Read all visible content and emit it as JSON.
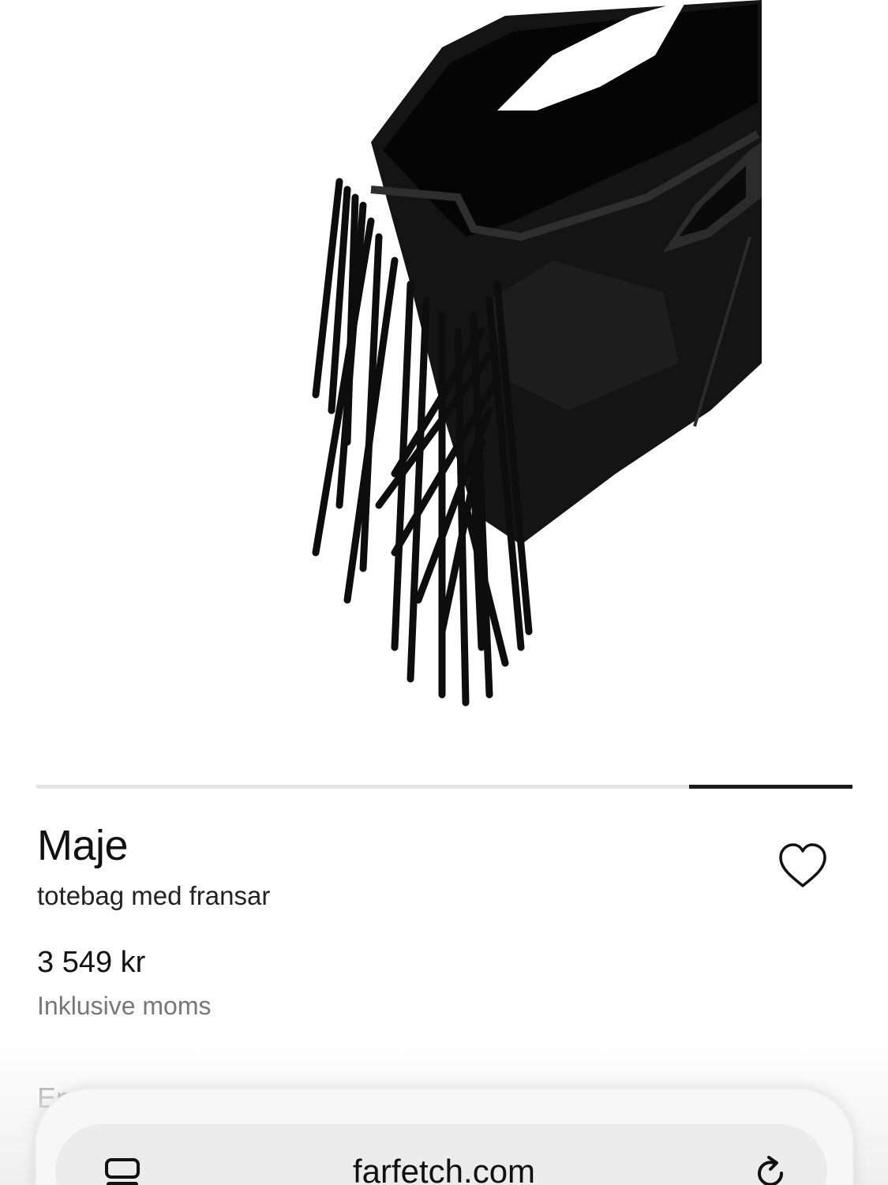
{
  "product": {
    "brand": "Maje",
    "name": "totebag med fransar",
    "price": "3 549 kr",
    "vat_note": "Inklusive moms",
    "partial_text": "En"
  },
  "carousel": {
    "active_fraction_start": 0.8,
    "active_fraction_end": 1.0
  },
  "browser": {
    "domain": "farfetch.com",
    "tabs_icon": "tabs-icon",
    "reload_icon": "reload-icon"
  },
  "icons": {
    "wishlist": "heart-icon"
  },
  "colors": {
    "text": "#111111",
    "muted": "#777777",
    "track": "#e6e6e6",
    "track_active": "#1a1a1a"
  }
}
